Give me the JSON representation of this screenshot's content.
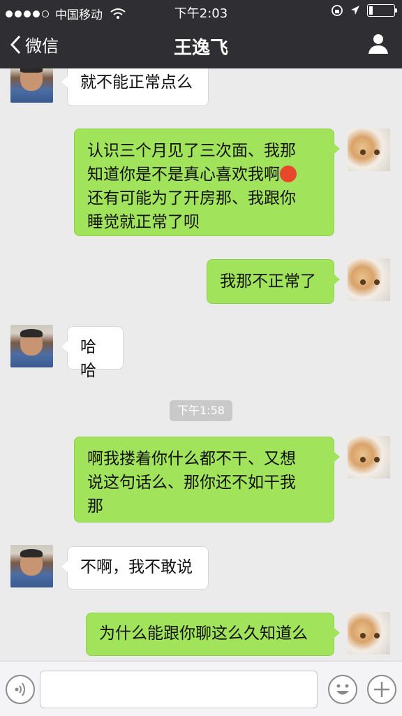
{
  "status_bar": {
    "carrier": "中国移动",
    "time": "下午2:03"
  },
  "nav": {
    "back_label": "微信",
    "title": "王逸飞"
  },
  "messages": [
    {
      "side": "left",
      "text": "就不能正常点么"
    },
    {
      "side": "right",
      "lines": [
        "认识三个月见了三次面、我那",
        "知道你是不是真心喜欢我啊",
        "还有可能为了开房那、我跟你",
        "睡觉就正常了呗"
      ]
    },
    {
      "side": "right",
      "text": "我那不正常了"
    },
    {
      "side": "left",
      "text": "哈哈"
    },
    {
      "timestamp": "下午1:58"
    },
    {
      "side": "right",
      "lines": [
        "啊我搂着你什么都不干、又想",
        "说这句话么、那你还不如干我",
        "那"
      ]
    },
    {
      "side": "left",
      "text": "不啊，我不敢说"
    },
    {
      "side": "right",
      "text": "为什么能跟你聊这么久知道么"
    }
  ],
  "input_bar": {
    "placeholder": ""
  },
  "colors": {
    "header_bg": "#2f2f33",
    "chat_bg": "#ebebeb",
    "bubble_me": "#a1e35b",
    "bubble_them": "#ffffff"
  }
}
